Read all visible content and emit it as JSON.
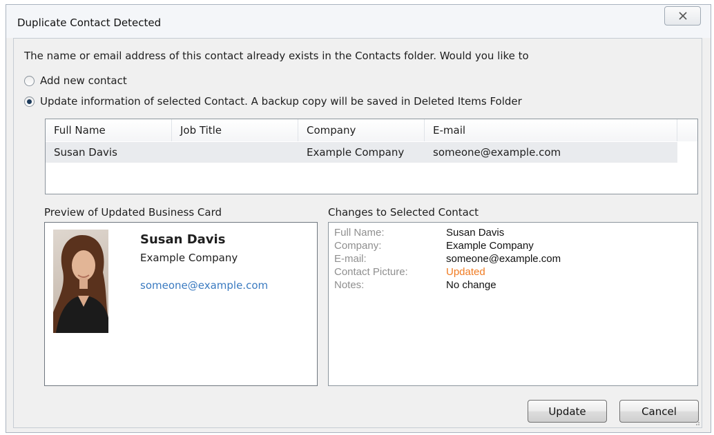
{
  "window": {
    "title": "Duplicate Contact Detected",
    "close_icon": "close-icon"
  },
  "prompt": "The name or email address of this contact already exists in the Contacts folder. Would you like to",
  "options": {
    "add_new": {
      "label": "Add new contact",
      "selected": false
    },
    "update": {
      "label": "Update information of selected Contact. A backup copy will be saved in Deleted Items Folder",
      "selected": true
    }
  },
  "contacts_table": {
    "columns": [
      "Full Name",
      "Job Title",
      "Company",
      "E-mail"
    ],
    "rows": [
      {
        "full_name": "Susan Davis",
        "job_title": "",
        "company": "Example Company",
        "email": "someone@example.com"
      }
    ]
  },
  "preview": {
    "label": "Preview of Updated Business Card",
    "name": "Susan Davis",
    "company": "Example Company",
    "email": "someone@example.com",
    "email_color": "#3a7ac0"
  },
  "changes": {
    "label": "Changes to Selected Contact",
    "items": [
      {
        "field": "Full Name:",
        "value": "Susan Davis"
      },
      {
        "field": "Company:",
        "value": "Example Company"
      },
      {
        "field": "E-mail:",
        "value": "someone@example.com"
      },
      {
        "field": "Contact Picture:",
        "value": "Updated",
        "highlight": "#f07b22"
      },
      {
        "field": "Notes:",
        "value": "No change"
      }
    ]
  },
  "buttons": {
    "update": "Update",
    "cancel": "Cancel"
  }
}
